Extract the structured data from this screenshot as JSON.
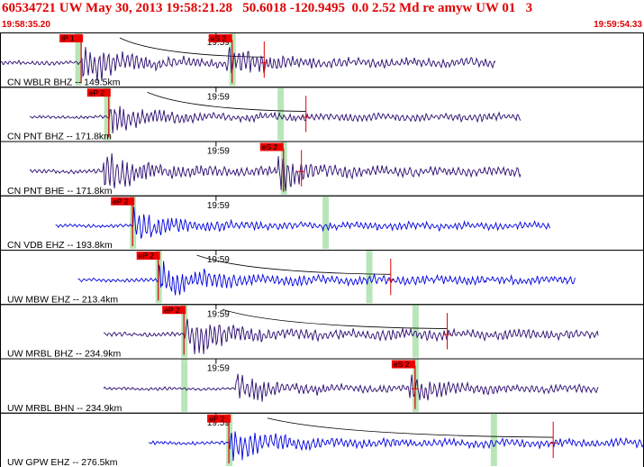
{
  "header": {
    "title": "60534721 UW May 30, 2013 19:58:21.28   50.6018 -120.9495  0.0 2.52 Md re amyw UW 01   3",
    "time_start": "19:58:35.20",
    "time_end": "19:59:54.33"
  },
  "colors": {
    "background": "#ffffff",
    "header_text": "#e00000",
    "trace_dark": "#2a0a6e",
    "trace_blue": "#0000e0",
    "pick_box": "#ee0000",
    "pick_line": "#e00000",
    "highlight": "#b8e6b8",
    "border": "#000000",
    "moveout_curve": "#000000"
  },
  "chart_data": {
    "type": "seismogram",
    "minute_label": "19:59",
    "traces": [
      {
        "label": "CN WBLR BHZ -- 149.5km",
        "color": "dark",
        "start": 0.0,
        "end": 0.77,
        "pick_label": "iP 1",
        "p_time": 0.125,
        "s_label": "eS 2",
        "s_time": 0.36,
        "marker": 0.41,
        "highlights": [
          0.12,
          0.36
        ],
        "amp": 0.6,
        "curve": true
      },
      {
        "label": "CN PNT BHZ -- 171.8km",
        "color": "dark",
        "start": 0.045,
        "end": 0.81,
        "pick_label": "eP 2",
        "p_time": 0.168,
        "s_label": "",
        "s_time": null,
        "marker": 0.475,
        "highlights": [
          0.165,
          0.435
        ],
        "amp": 0.5,
        "curve": true
      },
      {
        "label": "CN PNT BHE -- 171.8km",
        "color": "dark",
        "start": 0.045,
        "end": 0.81,
        "pick_label": "",
        "p_time": null,
        "s_label": "eS 2",
        "s_time": 0.44,
        "marker": 0.468,
        "highlights": [
          0.44
        ],
        "amp": 0.6,
        "curve": false
      },
      {
        "label": "CN VDB EHZ -- 193.8km",
        "color": "blue",
        "start": 0.085,
        "end": 0.855,
        "pick_label": "eP 2",
        "p_time": 0.205,
        "s_label": "",
        "s_time": null,
        "marker": null,
        "highlights": [
          0.205,
          0.505
        ],
        "amp": 0.5,
        "curve": false
      },
      {
        "label": "UW MBW EHZ -- 213.4km",
        "color": "blue",
        "start": 0.12,
        "end": 0.895,
        "pick_label": "eP 2",
        "p_time": 0.245,
        "s_label": "",
        "s_time": null,
        "marker": 0.607,
        "highlights": [
          0.245,
          0.573
        ],
        "amp": 0.6,
        "curve": true
      },
      {
        "label": "UW MRBL BHZ -- 234.9km",
        "color": "dark",
        "start": 0.16,
        "end": 0.93,
        "pick_label": "eP 2",
        "p_time": 0.285,
        "s_label": "",
        "s_time": null,
        "marker": 0.695,
        "highlights": [
          0.285,
          0.645
        ],
        "amp": 0.65,
        "curve": true
      },
      {
        "label": "UW MRBL BHN -- 234.9km",
        "color": "dark",
        "start": 0.16,
        "end": 0.93,
        "pick_label": "",
        "p_time": null,
        "s_label": "eS 2",
        "s_time": 0.645,
        "marker": 0.645,
        "highlights": [
          0.285,
          0.645
        ],
        "amp": 0.5,
        "curve": false
      },
      {
        "label": "UW GPW EHZ -- 276.5km",
        "color": "blue",
        "start": 0.23,
        "end": 1.0,
        "pick_label": "eP 2",
        "p_time": 0.355,
        "s_label": "",
        "s_time": null,
        "marker": 0.86,
        "highlights": [
          0.355,
          0.767
        ],
        "amp": 0.55,
        "curve": true
      }
    ],
    "minute_tick": 0.335,
    "grid": false,
    "legend": "none"
  }
}
